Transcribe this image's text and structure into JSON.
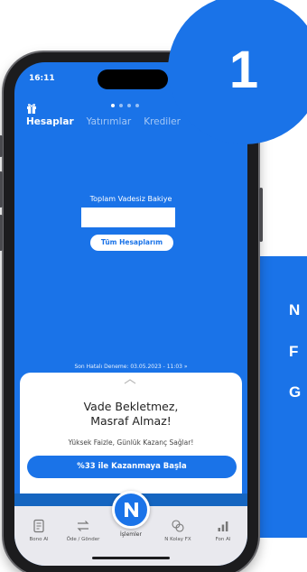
{
  "badge": {
    "number": "1"
  },
  "side_text": [
    "N",
    "F",
    "G"
  ],
  "status": {
    "time": "16:11"
  },
  "tabs": [
    {
      "label": "Hesaplar",
      "active": true
    },
    {
      "label": "Yatırımlar",
      "active": false
    },
    {
      "label": "Krediler",
      "active": false
    }
  ],
  "balance": {
    "label": "Toplam Vadesiz Bakiye",
    "all_accounts_label": "Tüm Hesaplarım"
  },
  "last_failed": "Son Hatalı Deneme: 03.05.2023 - 11:03 »",
  "promo": {
    "title_line1": "Vade Bekletmez,",
    "title_line2": "Masraf Almaz!",
    "subtitle": "Yüksek Faizle, Günlük Kazanç Sağlar!",
    "cta": "%33 ile Kazanmaya Başla"
  },
  "bottom_nav": {
    "items": [
      {
        "label": "Bono Al",
        "icon": "document-icon"
      },
      {
        "label": "Öde / Gönder",
        "icon": "transfer-icon"
      },
      {
        "label": "N Kolay FX",
        "icon": "currency-exchange-icon"
      },
      {
        "label": "Fon Al",
        "icon": "bar-chart-icon"
      }
    ],
    "center_label": "İşlemler",
    "center_icon": "brand-n-icon"
  },
  "colors": {
    "brand_blue": "#1a73e8",
    "nav_bg": "#e9e9ee"
  }
}
